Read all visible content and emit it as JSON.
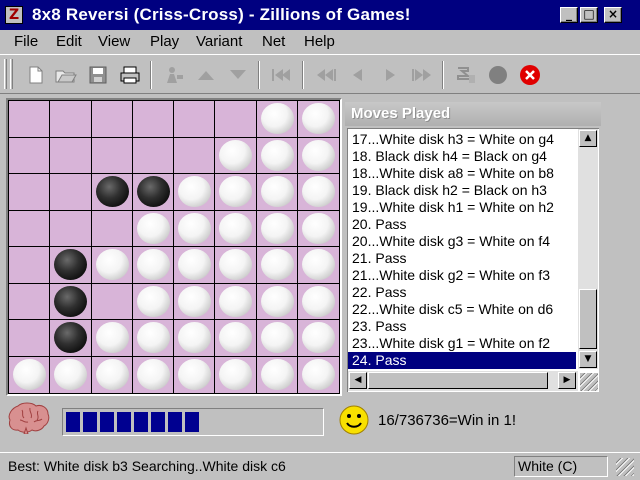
{
  "window": {
    "title": "8x8 Reversi (Criss-Cross) - Zillions of Games!",
    "minimize_glyph": "_",
    "maximize_glyph": "□",
    "close_glyph": "×"
  },
  "menu": {
    "items": [
      {
        "label": "File",
        "underline": "F"
      },
      {
        "label": "Edit",
        "underline": "E"
      },
      {
        "label": "View",
        "underline": "V"
      },
      {
        "label": "Play",
        "underline": "P"
      },
      {
        "label": "Variant",
        "underline": "a"
      },
      {
        "label": "Net",
        "underline": "N"
      },
      {
        "label": "Help",
        "underline": "H"
      }
    ]
  },
  "toolbar": {
    "icons": [
      "new-icon",
      "open-icon",
      "save-icon",
      "print-icon",
      "player-icon",
      "up-arrow-icon",
      "down-arrow-icon",
      "rewind-start-icon",
      "rewind-icon",
      "step-back-icon",
      "step-forward-icon",
      "fast-forward-icon",
      "settings-icon",
      "stone-icon",
      "stop-icon"
    ],
    "accent_stop": "#e00000"
  },
  "board": {
    "rows": [
      [
        "",
        "",
        "",
        "",
        "",
        "",
        "W",
        "W"
      ],
      [
        "",
        "",
        "",
        "",
        "",
        "W",
        "W",
        "W"
      ],
      [
        "",
        "",
        "B",
        "B",
        "W",
        "W",
        "W",
        "W"
      ],
      [
        "",
        "",
        "",
        "W",
        "W",
        "W",
        "W",
        "W"
      ],
      [
        "",
        "B",
        "W",
        "W",
        "W",
        "W",
        "W",
        "W"
      ],
      [
        "",
        "B",
        "",
        "W",
        "W",
        "W",
        "W",
        "W"
      ],
      [
        "",
        "B",
        "W",
        "W",
        "W",
        "W",
        "W",
        "W"
      ],
      [
        "W",
        "W",
        "W",
        "W",
        "W",
        "W",
        "W",
        "W"
      ]
    ],
    "light_squares": [
      [
        3,
        3
      ],
      [
        3,
        4
      ],
      [
        4,
        3
      ],
      [
        4,
        4
      ],
      [
        0,
        6
      ],
      [
        1,
        6
      ]
    ],
    "colors": {
      "square": "#d8b4d8",
      "lines": "#000000"
    }
  },
  "moves": {
    "heading": "Moves Played",
    "lines": [
      "17...White disk h3 = White on g4",
      "18. Black disk h4 = Black on g4",
      "18...White disk a8 = White on b8",
      "19. Black disk h2 = Black on h3",
      "19...White disk h1 = White on h2",
      "20. Pass",
      "20...White disk g3 = White on f4",
      "21. Pass",
      "21...White disk g2 = White on f3",
      "22. Pass",
      "22...White disk c5 = White on d6",
      "23. Pass",
      "23...White disk g1 = White on f2",
      "24. Pass"
    ],
    "selected_index": 13,
    "selected_color": "#000080"
  },
  "status": {
    "progress_blocks": 8,
    "message": "16/736736=Win in 1!",
    "best_line": "Best: White disk b3  Searching..White disk c6",
    "player": "White (C)"
  }
}
